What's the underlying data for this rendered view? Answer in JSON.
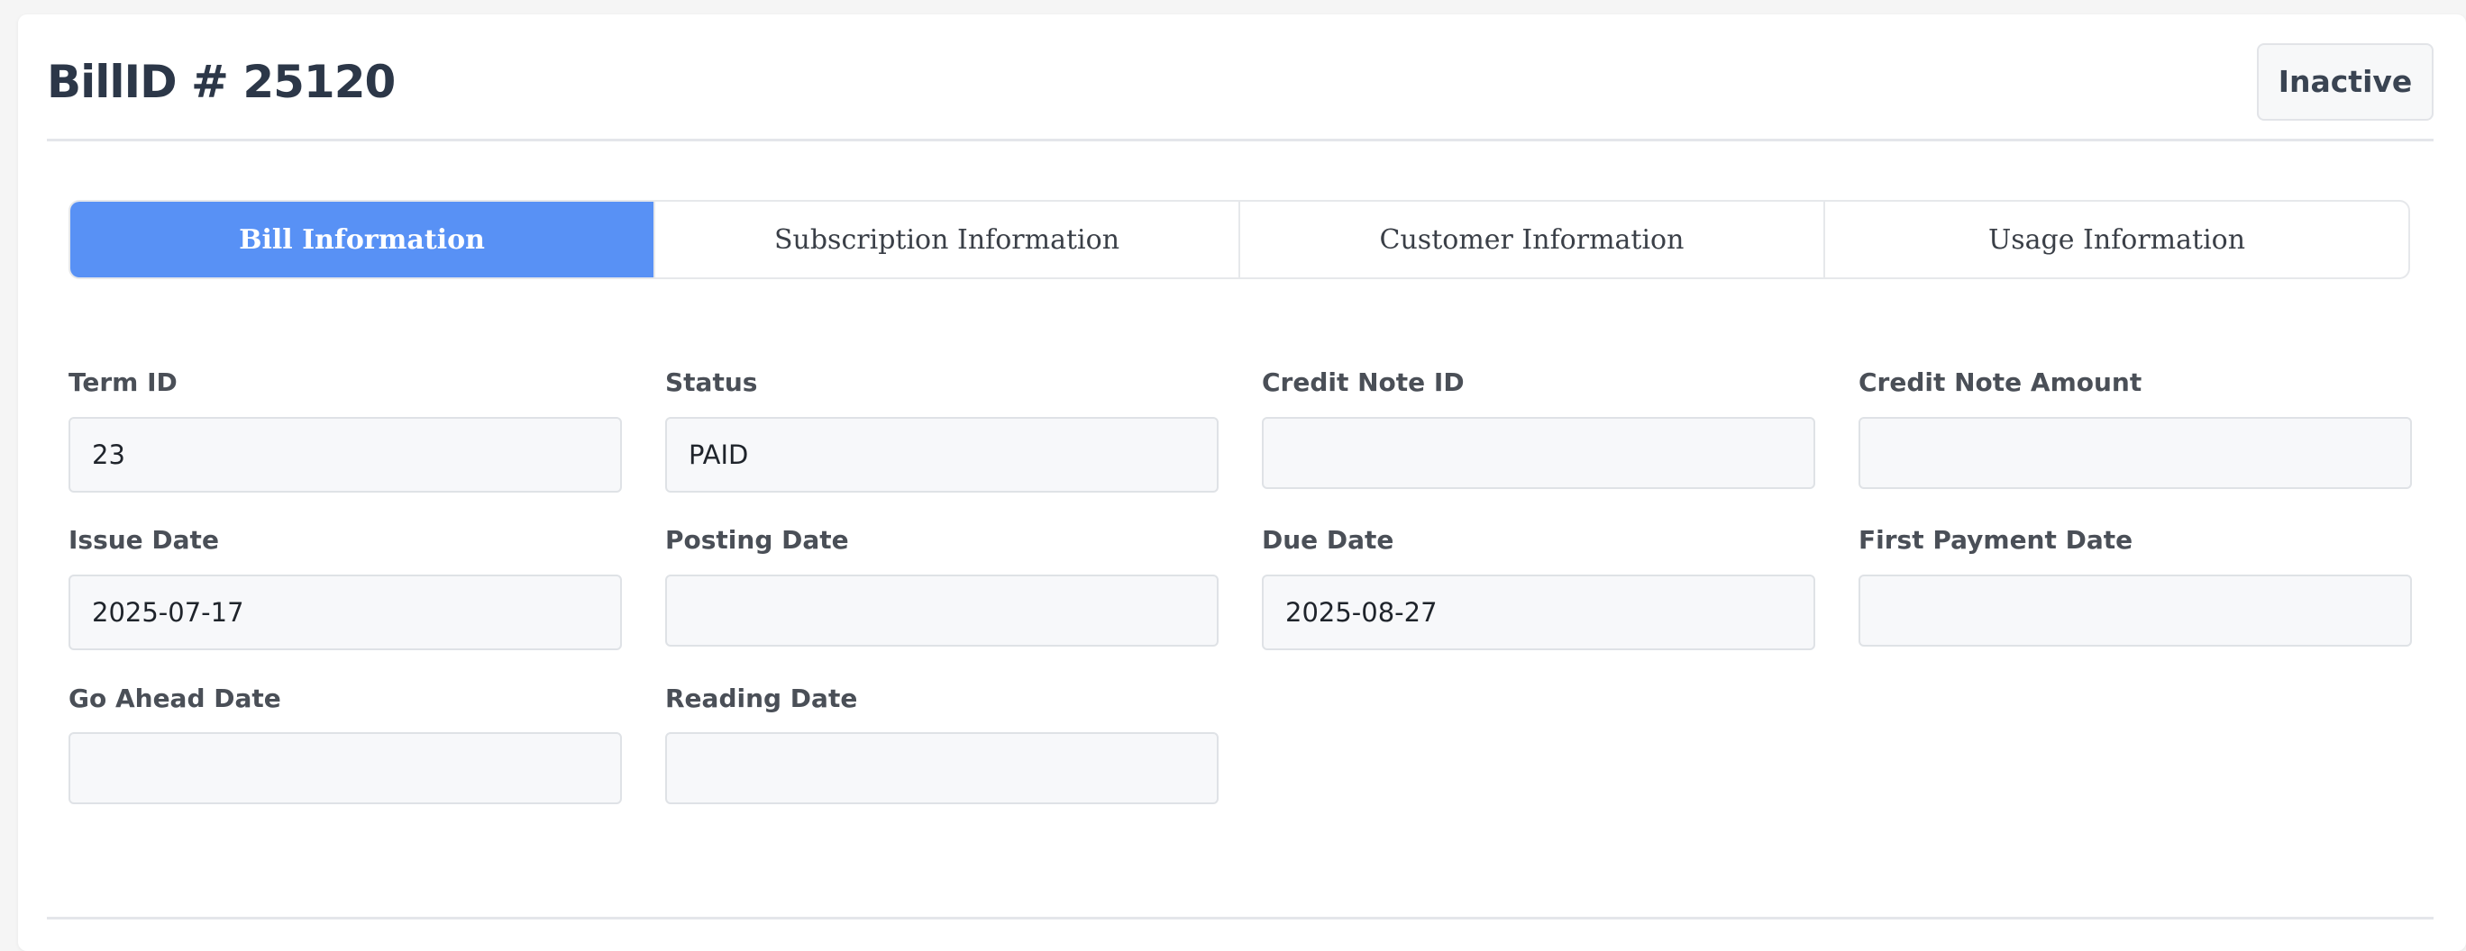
{
  "header": {
    "title": "BillID # 25120",
    "status_label": "Inactive"
  },
  "tabs": [
    {
      "label": "Bill Information",
      "active": true
    },
    {
      "label": "Subscription Information",
      "active": false
    },
    {
      "label": "Customer Information",
      "active": false
    },
    {
      "label": "Usage Information",
      "active": false
    }
  ],
  "fields": {
    "term_id": {
      "label": "Term ID",
      "value": "23"
    },
    "status": {
      "label": "Status",
      "value": "PAID"
    },
    "credit_note_id": {
      "label": "Credit Note ID",
      "value": ""
    },
    "credit_note_amount": {
      "label": "Credit Note Amount",
      "value": ""
    },
    "issue_date": {
      "label": "Issue Date",
      "value": "2025-07-17"
    },
    "posting_date": {
      "label": "Posting Date",
      "value": ""
    },
    "due_date": {
      "label": "Due Date",
      "value": "2025-08-27"
    },
    "first_payment_date": {
      "label": "First Payment Date",
      "value": ""
    },
    "go_ahead_date": {
      "label": "Go Ahead Date",
      "value": ""
    },
    "reading_date": {
      "label": "Reading Date",
      "value": ""
    }
  },
  "colors": {
    "accent": "#5891f5",
    "title_text": "#2c3748",
    "field_background": "#f7f8fa"
  }
}
